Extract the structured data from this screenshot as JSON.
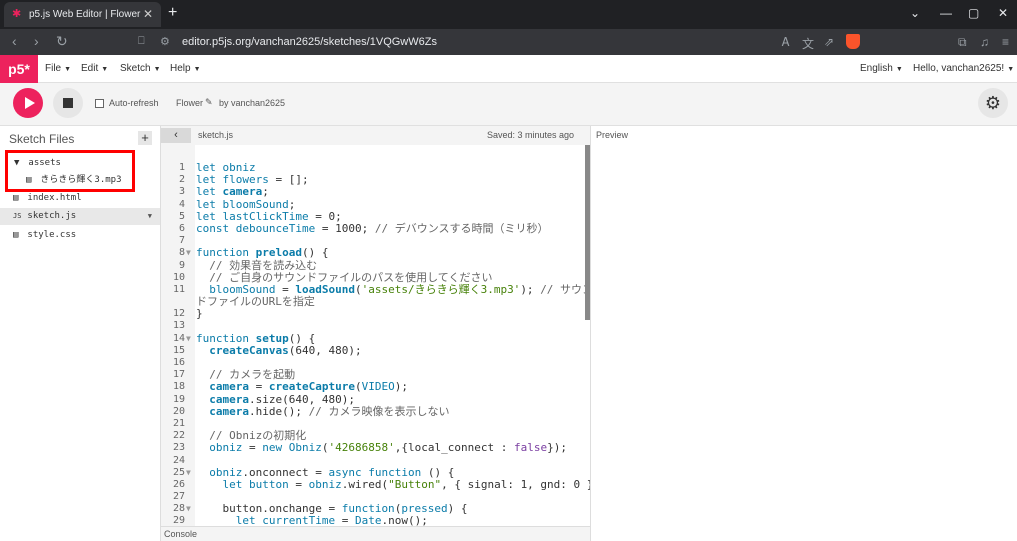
{
  "browser": {
    "tab_title": "p5.js Web Editor | Flower",
    "url": "editor.p5js.org/vanchan2625/sketches/1VQGwW6Zs",
    "tab_favicon": "p5-asterisk-icon"
  },
  "app": {
    "logo": "p5*",
    "menus": [
      "File",
      "Edit",
      "Sketch",
      "Help"
    ],
    "language": "English",
    "greeting": "Hello, vanchan2625!",
    "accent_color": "#ed225d"
  },
  "toolbar": {
    "auto_refresh_label": "Auto-refresh",
    "auto_refresh_checked": false,
    "sketch_name": "Flower",
    "by_user": "by vanchan2625"
  },
  "sidebar": {
    "title": "Sketch Files",
    "files": [
      {
        "name": "assets",
        "type": "folder",
        "expanded": true
      },
      {
        "name": "きらきら輝く3.mp3",
        "type": "file"
      },
      {
        "name": "index.html",
        "type": "file"
      },
      {
        "name": "sketch.js",
        "type": "file",
        "selected": true
      },
      {
        "name": "style.css",
        "type": "file"
      }
    ]
  },
  "editor": {
    "filename": "sketch.js",
    "saved_status": "Saved: 3 minutes ago",
    "line_numbers": [
      "1",
      "2",
      "3",
      "4",
      "5",
      "6",
      "7",
      "8",
      "9",
      "10",
      "11",
      "12",
      "13",
      "14",
      "15",
      "16",
      "17",
      "18",
      "19",
      "20",
      "21",
      "22",
      "23",
      "24",
      "25",
      "26",
      "27",
      "28",
      "29"
    ]
  },
  "console_label": "Console",
  "preview_label": "Preview"
}
